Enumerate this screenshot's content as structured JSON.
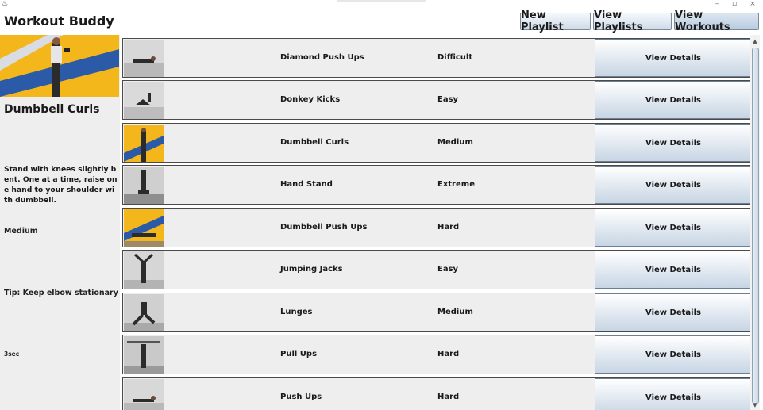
{
  "window": {
    "icon": "java-app-icon",
    "controls": {
      "minimize": "–",
      "maximize": "▫",
      "close": "×"
    }
  },
  "header": {
    "title": "Workout Buddy",
    "buttons": {
      "new_playlist": "New Playlist",
      "view_playlists": "View Playlists",
      "view_workouts": "View Workouts"
    }
  },
  "detail": {
    "title": "Dumbbell Curls",
    "description": "Stand with knees slightly bent. One at a time, raise one hand to your shoulder with dumbbell.",
    "difficulty": "Medium",
    "tip": "Tip: Keep elbow stationary",
    "duration": "3sec"
  },
  "workouts": [
    {
      "name": "Diamond Push Ups",
      "difficulty": "Difficult",
      "action": "View Details",
      "thumb": "floor-pushup"
    },
    {
      "name": "Donkey Kicks",
      "difficulty": "Easy",
      "action": "View Details",
      "thumb": "floor-kick"
    },
    {
      "name": "Dumbbell Curls",
      "difficulty": "Medium",
      "action": "View Details",
      "thumb": "stripe-stand"
    },
    {
      "name": "Hand Stand",
      "difficulty": "Extreme",
      "action": "View Details",
      "thumb": "handstand"
    },
    {
      "name": "Dumbbell Push Ups",
      "difficulty": "Hard",
      "action": "View Details",
      "thumb": "stripe-floor"
    },
    {
      "name": "Jumping Jacks",
      "difficulty": "Easy",
      "action": "View Details",
      "thumb": "jump"
    },
    {
      "name": "Lunges",
      "difficulty": "Medium",
      "action": "View Details",
      "thumb": "lunge"
    },
    {
      "name": "Pull Ups",
      "difficulty": "Hard",
      "action": "View Details",
      "thumb": "pullup"
    },
    {
      "name": "Push Ups",
      "difficulty": "Hard",
      "action": "View Details",
      "thumb": "floor-pushup"
    }
  ],
  "colors": {
    "accent_yellow": "#f3b71b",
    "accent_blue": "#2a5aa8",
    "button_gradient_top": "#ffffff",
    "button_gradient_bottom": "#c7d5e4"
  }
}
